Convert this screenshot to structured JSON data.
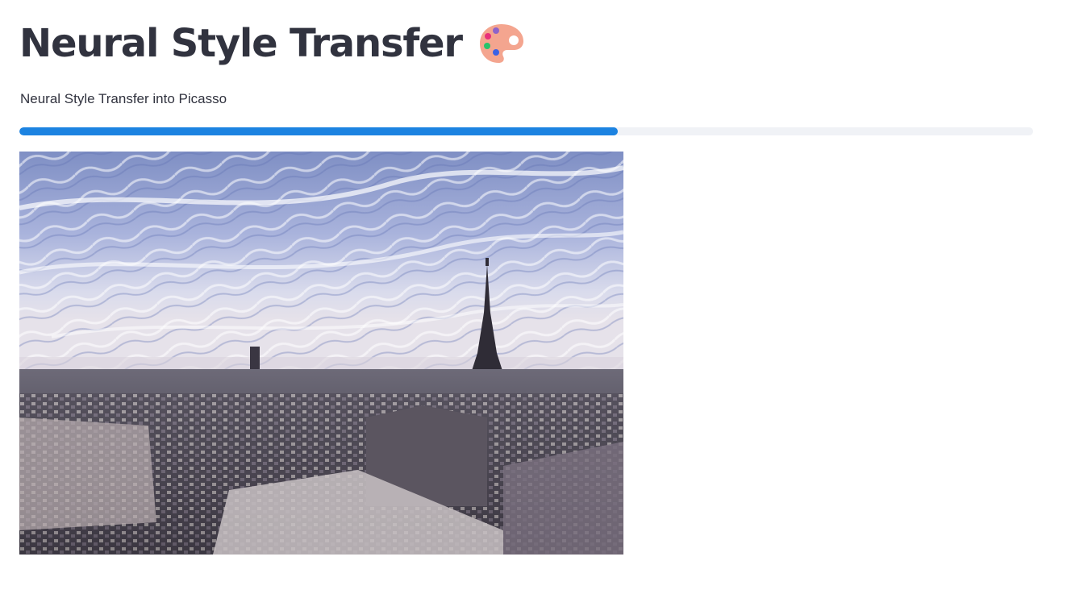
{
  "header": {
    "title": "Neural Style Transfer",
    "emoji_icon": "artist-palette-icon"
  },
  "subtitle": "Neural Style Transfer into Picasso",
  "progress": {
    "value_percent": 59,
    "fill_color": "#1c83e1",
    "track_color": "#f0f2f6"
  },
  "output_image": {
    "icon": "stylized-paris-rooftops-with-eiffel-tower"
  }
}
